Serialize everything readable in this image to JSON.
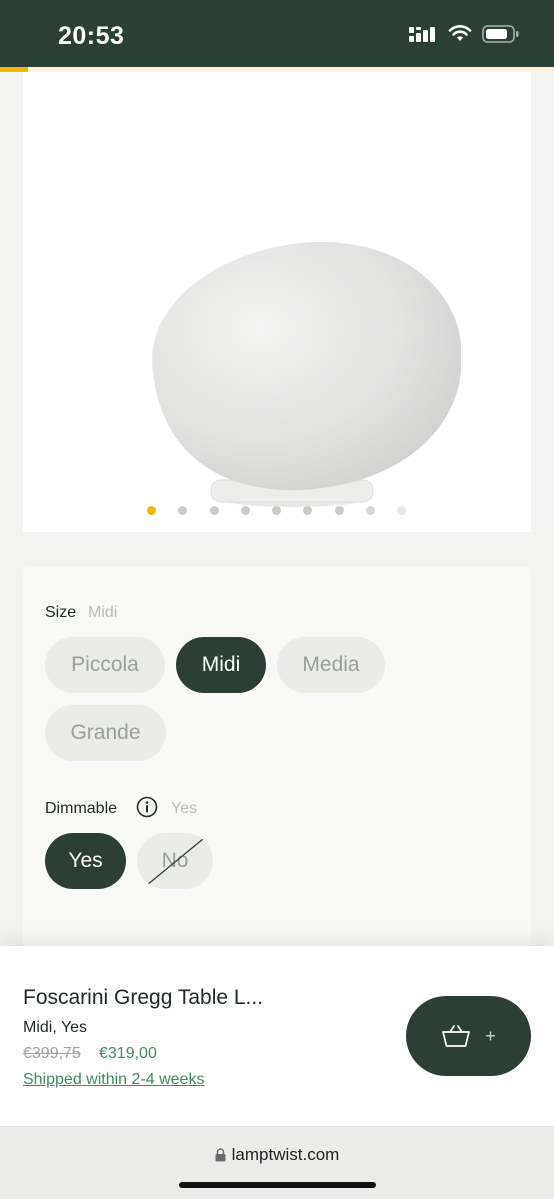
{
  "status_bar": {
    "time": "20:53"
  },
  "scroll_progress_fraction": 0.05,
  "gallery": {
    "image": "lamp-product-image",
    "dot_count": 9,
    "active_dot_index": 0
  },
  "options": {
    "size": {
      "label": "Size",
      "selected": "Midi",
      "choices": [
        "Piccola",
        "Midi",
        "Media",
        "Grande"
      ]
    },
    "dimmable": {
      "label": "Dimmable",
      "selected": "Yes",
      "choices": [
        "Yes",
        "No"
      ],
      "unavailable": [
        "No"
      ]
    }
  },
  "product": {
    "name": "Foscarini Gregg Table L...",
    "variant": "Midi, Yes",
    "old_price": "€399,75",
    "price": "€319,00",
    "shipping": "Shipped within 2-4 weeks",
    "cart_plus": "+"
  },
  "browser": {
    "url": "lamptwist.com"
  },
  "colors": {
    "brand_dark": "#2b3f33",
    "accent_yellow": "#f2b705",
    "price_green": "#3e8a62"
  }
}
